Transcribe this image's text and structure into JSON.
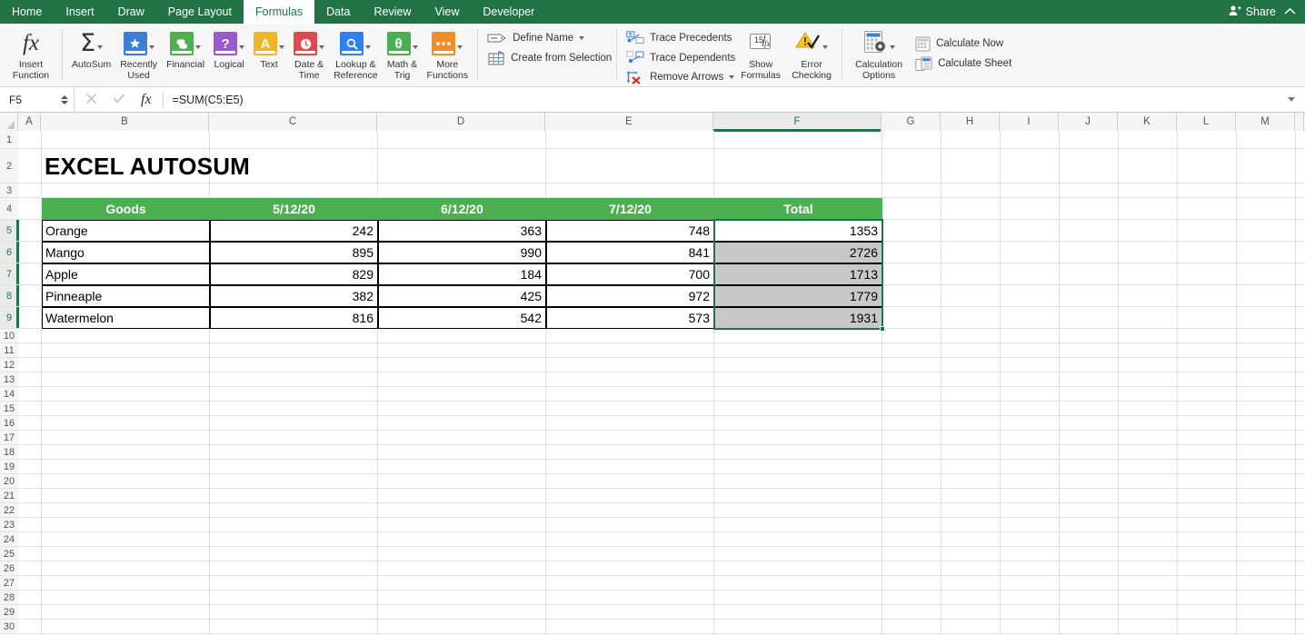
{
  "tabbar": {
    "tabs": [
      {
        "label": "Home",
        "active": false
      },
      {
        "label": "Insert",
        "active": false
      },
      {
        "label": "Draw",
        "active": false
      },
      {
        "label": "Page Layout",
        "active": false
      },
      {
        "label": "Formulas",
        "active": true
      },
      {
        "label": "Data",
        "active": false
      },
      {
        "label": "Review",
        "active": false
      },
      {
        "label": "View",
        "active": false
      },
      {
        "label": "Developer",
        "active": false
      }
    ],
    "share_label": "Share",
    "share_icon": "person-add-icon",
    "collapse_icon": "chevron-up-icon",
    "brand_color": "#217346"
  },
  "ribbon": {
    "insert_function": {
      "label": "Insert\nFunction",
      "icon": "fx-icon"
    },
    "function_library": [
      {
        "label": "AutoSum",
        "icon": "sigma-icon",
        "color": "#333333",
        "caret": true
      },
      {
        "label": "Recently\nUsed",
        "icon": "star-book-icon",
        "color": "#3a7fd5",
        "caret": true
      },
      {
        "label": "Financial",
        "icon": "coins-book-icon",
        "color": "#4caf50",
        "caret": true
      },
      {
        "label": "Logical",
        "icon": "question-book-icon",
        "color": "#9b59d0",
        "caret": true
      },
      {
        "label": "Text",
        "icon": "letter-a-book-icon",
        "color": "#f0b429",
        "caret": true
      },
      {
        "label": "Date &\nTime",
        "icon": "clock-book-icon",
        "color": "#e04a4a",
        "caret": true
      },
      {
        "label": "Lookup &\nReference",
        "icon": "magnifier-book-icon",
        "color": "#2f80ed",
        "caret": true
      },
      {
        "label": "Math &\nTrig",
        "icon": "theta-book-icon",
        "color": "#4caf50",
        "caret": true
      },
      {
        "label": "More\nFunctions",
        "icon": "dots-book-icon",
        "color": "#f28c28",
        "caret": true
      }
    ],
    "defined_names": [
      {
        "label": "Define Name",
        "icon": "define-name-icon",
        "caret": true
      },
      {
        "label": "Create from Selection",
        "icon": "create-from-selection-icon",
        "caret": false
      }
    ],
    "formula_auditing_small": [
      {
        "label": "Trace Precedents",
        "icon": "trace-precedents-icon",
        "caret": false
      },
      {
        "label": "Trace Dependents",
        "icon": "trace-dependents-icon",
        "caret": false
      },
      {
        "label": "Remove Arrows",
        "icon": "remove-arrows-icon",
        "caret": true
      }
    ],
    "formula_auditing_big": [
      {
        "label": "Show\nFormulas",
        "icon": "show-formulas-icon",
        "caret": false
      },
      {
        "label": "Error\nChecking",
        "icon": "error-checking-icon",
        "caret": true
      }
    ],
    "calculation": {
      "options": {
        "label": "Calculation\nOptions",
        "icon": "calculation-options-icon",
        "caret": true
      },
      "items": [
        {
          "label": "Calculate Now",
          "icon": "calculate-now-icon"
        },
        {
          "label": "Calculate Sheet",
          "icon": "calculate-sheet-icon"
        }
      ]
    }
  },
  "formula_bar": {
    "name_box": "F5",
    "name_box_placeholder": "Name Box",
    "cancel_icon": "close-icon",
    "confirm_icon": "check-icon",
    "fx_icon": "fx-icon",
    "formula": "=SUM(C5:E5)",
    "formula_placeholder": "",
    "expand_icon": "chevron-down-icon"
  },
  "grid": {
    "columns": [
      "A",
      "B",
      "C",
      "D",
      "E",
      "F",
      "G",
      "H",
      "I",
      "J",
      "K",
      "L",
      "M"
    ],
    "selected_column": "F",
    "rows": [
      1,
      2,
      3,
      4,
      5,
      6,
      7,
      8,
      9,
      10,
      11,
      12,
      13,
      14,
      15,
      16,
      17,
      18,
      19,
      20,
      21,
      22,
      23,
      24,
      25,
      26,
      27,
      28,
      29,
      30
    ],
    "selected_rows": [
      5,
      6,
      7,
      8,
      9
    ],
    "selection_range": "F5:F9",
    "active_cell": "F5"
  },
  "sheet": {
    "title": "EXCEL AUTOSUM",
    "header_fill": "#4caf50",
    "header_text_color": "#ffffff",
    "selection_fill": "#c8c8c8",
    "table": {
      "headers": [
        "Goods",
        "5/12/20",
        "6/12/20",
        "7/12/20",
        "Total"
      ],
      "rows": [
        {
          "goods": "Orange",
          "d1": "242",
          "d2": "363",
          "d3": "748",
          "total": "1353"
        },
        {
          "goods": "Mango",
          "d1": "895",
          "d2": "990",
          "d3": "841",
          "total": "2726"
        },
        {
          "goods": "Apple",
          "d1": "829",
          "d2": "184",
          "d3": "700",
          "total": "1713"
        },
        {
          "goods": "Pinneaple",
          "d1": "382",
          "d2": "425",
          "d3": "972",
          "total": "1779"
        },
        {
          "goods": "Watermelon",
          "d1": "816",
          "d2": "542",
          "d3": "573",
          "total": "1931"
        }
      ]
    }
  }
}
